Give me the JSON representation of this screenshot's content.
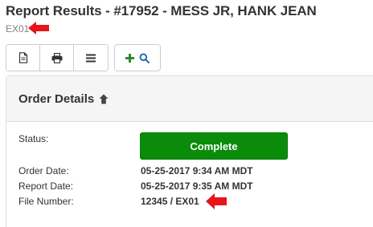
{
  "header": {
    "title": "Report Results - #17952 - MESS JR, HANK JEAN",
    "subtitle": "EX01"
  },
  "toolbar": {
    "buttons": [
      {
        "icon": "document-icon"
      },
      {
        "icon": "print-icon"
      },
      {
        "icon": "menu-icon"
      },
      {
        "icon": "add-search-icon"
      }
    ]
  },
  "panel": {
    "title": "Order Details",
    "fields": {
      "status_label": "Status:",
      "status_value": "Complete",
      "order_date_label": "Order Date:",
      "order_date_value": "05-25-2017 9:34 AM MDT",
      "report_date_label": "Report Date:",
      "report_date_value": "05-25-2017 9:35 AM MDT",
      "file_number_label": "File Number:",
      "file_number_value": "12345 / EX01"
    }
  },
  "colors": {
    "status_complete": "#0a8c0a",
    "annotation_arrow": "#e8141c",
    "add_icon": "#2e8b2e",
    "search_icon": "#2a6fb0"
  }
}
